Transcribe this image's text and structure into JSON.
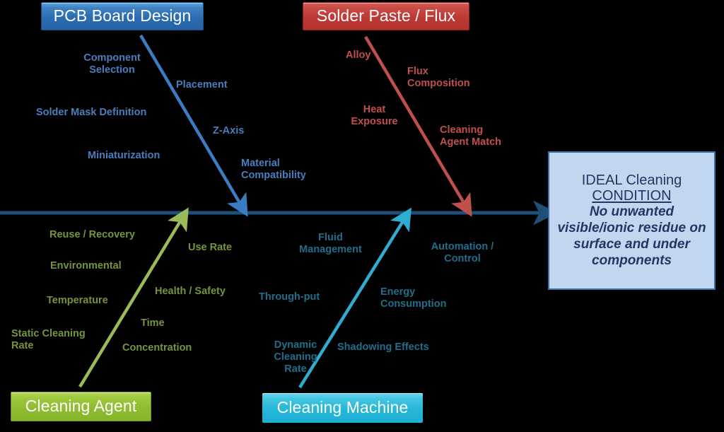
{
  "diagram": {
    "type": "fishbone-ishikawa",
    "title": "IDEAL Cleaning Condition Fishbone Diagram",
    "spine_color": "#1F4E79",
    "background": "#000000"
  },
  "categories": [
    {
      "id": "pcb-board-design",
      "label": "PCB Board Design",
      "position": "top-left",
      "color": "#2C6CB0",
      "text_color": "#4A7EBB",
      "causes": [
        "Component\nSelection",
        "Solder Mask Definition",
        "Miniaturization",
        "Placement",
        "Z-Axis",
        "Material\nCompatibility"
      ]
    },
    {
      "id": "solder-paste-flux",
      "label": "Solder Paste / Flux",
      "position": "top-right",
      "color": "#BC3A36",
      "text_color": "#C0504D",
      "causes": [
        "Alloy",
        "Heat\nExposure",
        "Flux\nComposition",
        "Cleaning\nAgent Match"
      ]
    },
    {
      "id": "cleaning-agent",
      "label": "Cleaning Agent",
      "position": "bottom-left",
      "color": "#8FBC32",
      "text_color": "#77933C",
      "causes": [
        "Reuse  / Recovery",
        "Environmental",
        "Temperature",
        "Static Cleaning\nRate",
        "Use Rate",
        "Health / Safety",
        "Time",
        "Concentration"
      ]
    },
    {
      "id": "cleaning-machine",
      "label": "Cleaning Machine",
      "position": "bottom-right",
      "color": "#26B7D8",
      "text_color": "#1F6F8C",
      "causes": [
        "Fluid\nManagement",
        "Through-put",
        "Dynamic\nCleaning\nRate",
        "Automation /\nControl",
        "Energy\nConsumption",
        "Shadowing Effects"
      ]
    }
  ],
  "effect": {
    "title_line1": "IDEAL Cleaning",
    "title_line2": "CONDITION",
    "body": "No unwanted visible/ionic residue on surface and under components",
    "fill": "#C3D6EF",
    "border": "#3A6FA8",
    "text_color": "#1F3864"
  },
  "labels": {
    "pcb": {
      "component_selection": "Component\nSelection",
      "solder_mask_definition": "Solder Mask Definition",
      "miniaturization": "Miniaturization",
      "placement": "Placement",
      "z_axis": "Z-Axis",
      "material_compatibility": "Material\nCompatibility"
    },
    "flux": {
      "alloy": "Alloy",
      "heat_exposure": "Heat\nExposure",
      "flux_composition": "Flux\nComposition",
      "cleaning_agent_match": "Cleaning\nAgent Match"
    },
    "agent": {
      "reuse_recovery": "Reuse  / Recovery",
      "environmental": "Environmental",
      "temperature": "Temperature",
      "static_cleaning_rate": "Static Cleaning\nRate",
      "use_rate": "Use Rate",
      "health_safety": "Health / Safety",
      "time": "Time",
      "concentration": "Concentration"
    },
    "machine": {
      "fluid_management": "Fluid\nManagement",
      "through_put": "Through-put",
      "dynamic_cleaning_rate": "Dynamic\nCleaning\nRate",
      "automation_control": "Automation /\nControl",
      "energy_consumption": "Energy\nConsumption",
      "shadowing_effects": "Shadowing Effects"
    }
  }
}
